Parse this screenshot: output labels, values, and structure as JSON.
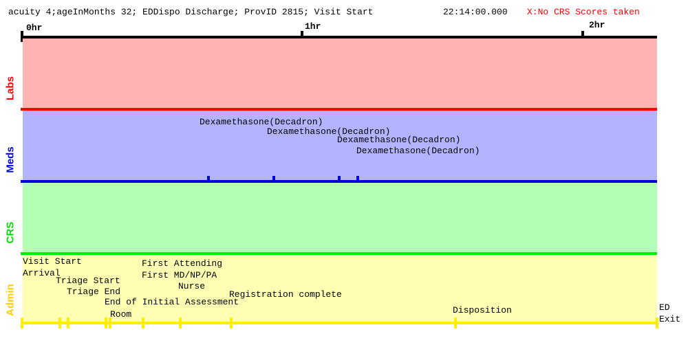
{
  "header": {
    "info": "acuity 4;ageInMonths 32; EDDispo Discharge; ProvID 2815; Visit Start",
    "time": "22:14:00.000",
    "warning": "X:No CRS Scores taken"
  },
  "axis": {
    "ticks": [
      "0hr",
      "1hr",
      "2hr"
    ]
  },
  "colors": {
    "labs_bg": "#ffb3b3",
    "labs_line": "#ff0000",
    "meds_bg": "#b3b3ff",
    "meds_line": "#0000dd",
    "crs_bg": "#b3ffb3",
    "crs_line": "#00ee00",
    "admin_bg": "#ffffb3",
    "admin_line": "#ffee00",
    "axis": "#000000"
  },
  "lanes": {
    "labs": "Labs",
    "meds": "Meds",
    "crs": "CRS",
    "admin": "Admin"
  },
  "meds_events": [
    "Dexamethasone(Decadron)",
    "Dexamethasone(Decadron)",
    "Dexamethasone(Decadron)",
    "Dexamethasone(Decadron)"
  ],
  "admin_events": [
    "Visit Start",
    "Arrival",
    "Triage Start",
    "Triage End",
    "End of Initial Assessment",
    "Room",
    "First Attending",
    "First MD/NP/PA",
    "Nurse",
    "Registration complete",
    "Disposition",
    "ED",
    "Exit"
  ]
}
